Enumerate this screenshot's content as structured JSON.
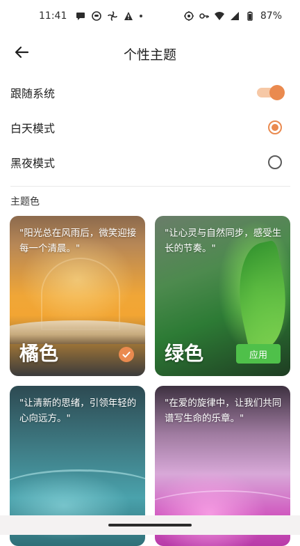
{
  "status_bar": {
    "time": "11:41",
    "battery_percent": "87%",
    "icons_left": [
      "message-icon",
      "face-icon",
      "fan-icon",
      "warning-icon",
      "dot-icon"
    ],
    "icons_right": [
      "location-icon",
      "key-icon",
      "wifi-icon",
      "signal-icon",
      "battery-icon"
    ]
  },
  "header": {
    "title": "个性主题",
    "back_icon": "back-arrow-icon"
  },
  "settings": {
    "follow_system": {
      "label": "跟随系统",
      "enabled": true
    },
    "day_mode": {
      "label": "白天模式",
      "selected": true
    },
    "night_mode": {
      "label": "黑夜模式",
      "selected": false
    }
  },
  "theme_section": {
    "title": "主题色",
    "cards": [
      {
        "quote": "\"阳光总在风雨后，微笑迎接每一个清晨。\"",
        "name": "橘色",
        "selected": true
      },
      {
        "quote": "\"让心灵与自然同步，感受生长的节奏。\"",
        "name": "绿色",
        "button": "应用"
      },
      {
        "quote": "\"让清新的思绪，引领年轻的心向远方。\""
      },
      {
        "quote": "\"在爱的旋律中，让我们共同谱写生命的乐章。\""
      }
    ]
  },
  "colors": {
    "accent": "#ea8a4f",
    "toggle_track": "#f6c8a6",
    "apply_green": "#4fc04a"
  }
}
